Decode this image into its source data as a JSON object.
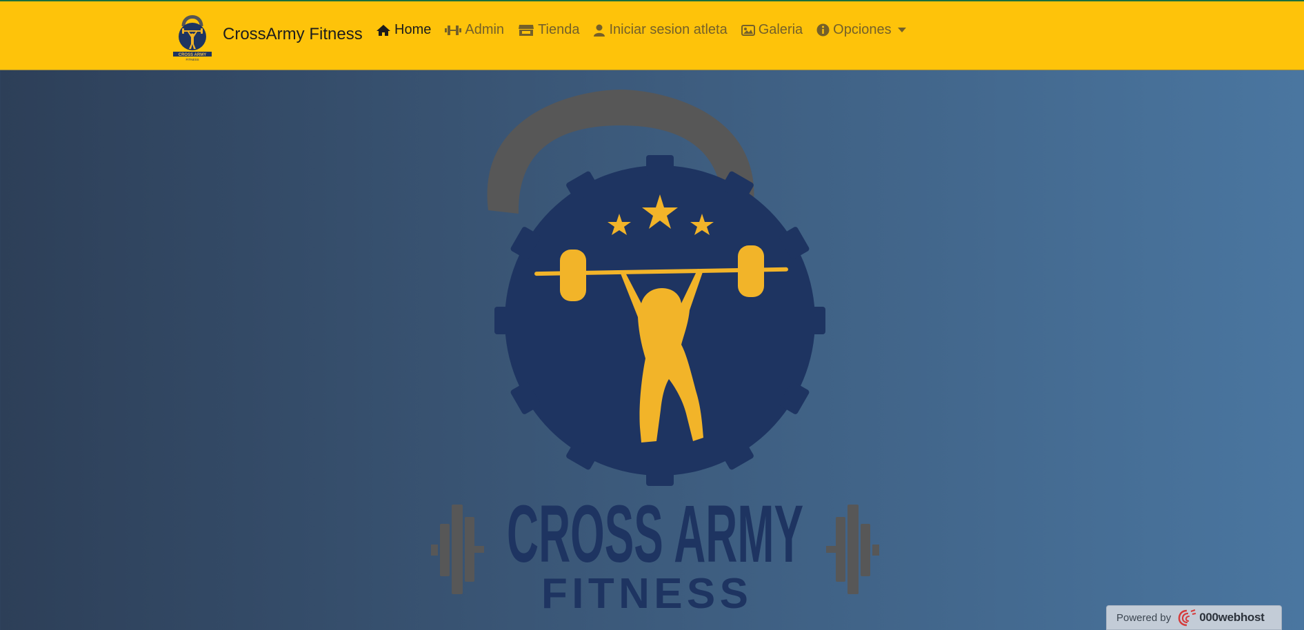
{
  "brand": {
    "name": "CrossArmy Fitness",
    "logo": "crossarmy-fitness-logo"
  },
  "nav": {
    "items": [
      {
        "label": "Home",
        "icon": "home-icon",
        "active": true
      },
      {
        "label": "Admin",
        "icon": "dumbbell-icon",
        "active": false
      },
      {
        "label": "Tienda",
        "icon": "store-icon",
        "active": false
      },
      {
        "label": "Iniciar sesion atleta",
        "icon": "user-icon",
        "active": false
      },
      {
        "label": "Galeria",
        "icon": "image-icon",
        "active": false
      },
      {
        "label": "Opciones",
        "icon": "info-circle-icon",
        "active": false,
        "dropdown": true
      }
    ]
  },
  "hero": {
    "logo_text_line1": "CROSS ARMY",
    "logo_text_line2": "FITNESS"
  },
  "badge": {
    "prefix": "Powered by",
    "name": "000webhost"
  },
  "colors": {
    "navbar": "#fec30a",
    "logo_navy": "#1e3461",
    "logo_gold": "#f2b429",
    "kettlebell_gray": "#575757"
  }
}
